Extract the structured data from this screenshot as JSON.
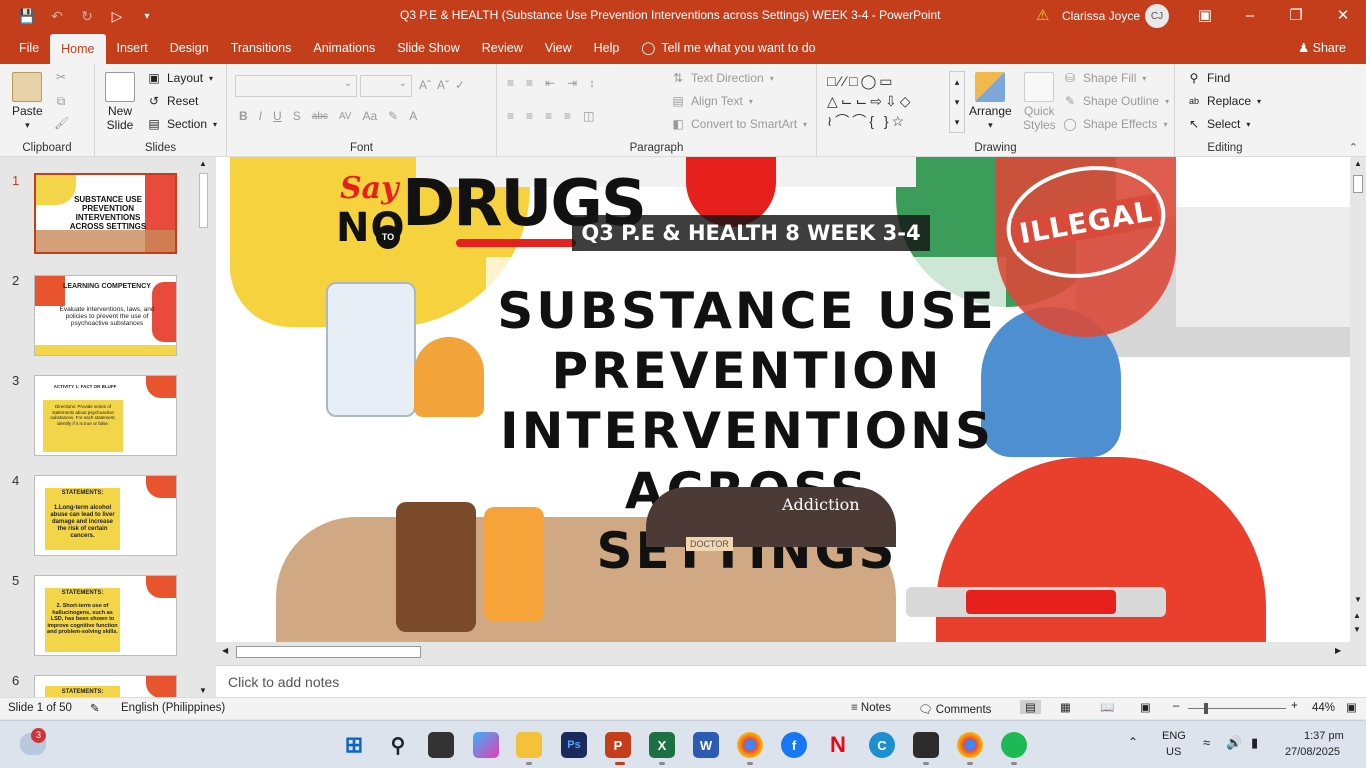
{
  "window": {
    "title": "Q3 P.E & HEALTH (Substance Use Prevention Interventions across Settings) WEEK 3-4  -  PowerPoint",
    "user": "Clarissa Joyce",
    "initials": "CJ"
  },
  "tabs": [
    "File",
    "Home",
    "Insert",
    "Design",
    "Transitions",
    "Animations",
    "Slide Show",
    "Review",
    "View",
    "Help"
  ],
  "tell_me": "Tell me what you want to do",
  "share": "Share",
  "ribbon": {
    "clipboard": {
      "label": "Clipboard",
      "paste": "Paste"
    },
    "slides": {
      "label": "Slides",
      "new_slide_1": "New",
      "new_slide_2": "Slide",
      "layout": "Layout",
      "reset": "Reset",
      "section": "Section"
    },
    "font": {
      "label": "Font"
    },
    "paragraph": {
      "label": "Paragraph",
      "text_direction": "Text Direction",
      "align_text": "Align Text",
      "convert": "Convert to SmartArt"
    },
    "drawing": {
      "label": "Drawing",
      "arrange": "Arrange",
      "quick_styles_1": "Quick",
      "quick_styles_2": "Styles",
      "shape_fill": "Shape Fill",
      "shape_outline": "Shape Outline",
      "shape_effects": "Shape Effects"
    },
    "editing": {
      "label": "Editing",
      "find": "Find",
      "replace": "Replace",
      "select": "Select"
    }
  },
  "thumbnails": [
    {
      "num": "1",
      "title": "SUBSTANCE USE PREVENTION INTERVENTIONS ACROSS SETTINGS"
    },
    {
      "num": "2",
      "title": "LEARNING COMPETENCY",
      "body": "Evaluate interventions, laws, and policies to prevent the use of psychoactive substances"
    },
    {
      "num": "3",
      "title": "ACTIVITY 1: FACT OR BLUFF",
      "body": "Directions: Provide series of statements about psychoactive substances. For each statement, identify if it is true or false."
    },
    {
      "num": "4",
      "title": "STATEMENTS:",
      "body": "1.Long-term alcohol abuse can lead to liver damage and increase the risk of certain cancers."
    },
    {
      "num": "5",
      "title": "STATEMENTS:",
      "body": "2. Short-term use of hallucinogens, such as LSD, has been shown to improve cognitive function and problem-solving skills."
    },
    {
      "num": "6",
      "title": "STATEMENTS:"
    }
  ],
  "slide": {
    "say": "Say",
    "no": "NO",
    "to": "TO",
    "drugs": "DRUGS",
    "banner": "Q3 P.E & HEALTH 8 WEEK 3-4",
    "illegal": "ILLEGAL",
    "title_lines": [
      "SUBSTANCE USE",
      "PREVENTION",
      "INTERVENTIONS",
      "ACROSS SETTINGS"
    ],
    "addiction": "Addiction",
    "doctor": "DOCTOR"
  },
  "notes_placeholder": "Click to add notes",
  "status": {
    "slide_info": "Slide 1 of 50",
    "language": "English (Philippines)",
    "notes": "Notes",
    "comments": "Comments",
    "zoom": "44%"
  },
  "taskbar": {
    "badge": "3",
    "lang_1": "ENG",
    "lang_2": "US",
    "time": "1:37 pm",
    "date": "27/08/2025"
  },
  "colors": {
    "accent": "#c43e1c",
    "ribbon": "#f3f3f3"
  }
}
